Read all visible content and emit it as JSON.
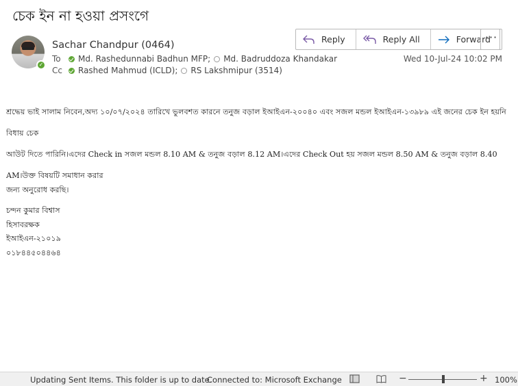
{
  "subject": "চেক ইন না হওয়া প্রসংগে",
  "sender": "Sachar Chandpur (0464)",
  "to_label": "To",
  "cc_label": "Cc",
  "to": [
    {
      "name": "Md. Rashedunnabi Badhun MFP;",
      "presence": "available"
    },
    {
      "name": "Md. Badruddoza Khandakar",
      "presence": "offline"
    }
  ],
  "cc": [
    {
      "name": "Rashed Mahmud (ICLD);",
      "presence": "available"
    },
    {
      "name": "RS Lakshmipur (3514)",
      "presence": "offline"
    }
  ],
  "date": "Wed 10-Jul-24 10:02 PM",
  "actions": {
    "reply": "Reply",
    "reply_all": "Reply All",
    "forward": "Forward",
    "more": "···"
  },
  "body": {
    "para1": "শ্রদ্ধেয় ভাই সালাম নিবেন,অদ্য ১০/০৭/২০২৪ তারিখে ভুলবশত কারনে তনুজ বড়াল ইআইএন-২০০৪০ এবং সজল মন্ডল ইআইএন-১৩৯৮৯ এই জনের  চেক ইন হয়নি বিধায় চেক",
    "para2": "আউট দিতে পারিনি।এদের Check in সজল মন্ডল 8.10 AM & তনুজ বড়াল 8.12 AM।এদের Check Out হয় সজল মন্ডল 8.50 AM & তনুজ বড়াল 8.40 AM।উক্ত বিষয়টি সমাধান করার",
    "para3": "জন্য অনুরোধ করছি।"
  },
  "signature": {
    "name": "চন্দন কুমার বিশ্বাস",
    "title": "হিসাবরক্ষক",
    "ein": "ইআইএন-২১০১৯",
    "phone": "০১৮৪৪৫০৪৪৬৪"
  },
  "status": {
    "left": "Updating Sent Items.  This folder is up to date.",
    "connection": "Connected to: Microsoft Exchange",
    "zoom": "100%",
    "zoom_fraction": 0.5
  },
  "colors": {
    "presence_available": "#5ea634",
    "accent": "#0f6cbd"
  }
}
